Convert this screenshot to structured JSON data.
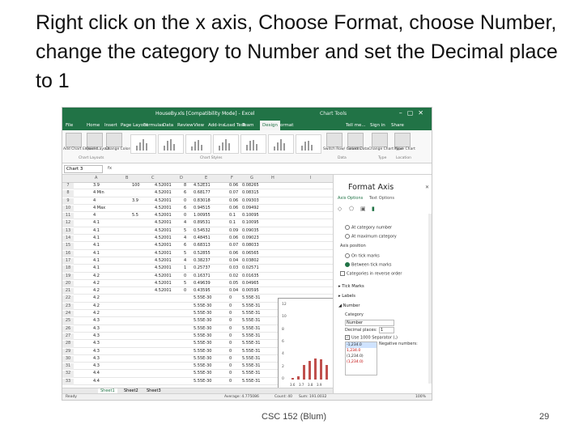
{
  "slide": {
    "title": "Right click on the x axis, Choose Format, choose Number, change the category to Number and set the Decimal place to 1",
    "footer_course": "CSC 152 (Blum)",
    "page_number": "29"
  },
  "excel": {
    "window_title": "HouseBy.xls [Compatibility Mode] - Excel",
    "chart_tools_label": "Chart Tools",
    "menu_tabs": [
      "File",
      "Home",
      "Insert",
      "Page Layout",
      "Formulas",
      "Data",
      "Review",
      "View",
      "Add-ins",
      "Load Test",
      "Team",
      "Design",
      "Format"
    ],
    "menu_right": [
      "Tell me...",
      "Sign in",
      "Share"
    ],
    "active_tab": "Design",
    "ribbon": {
      "add_chart_element": "Add Chart Element",
      "quick_layout": "Quick Layout",
      "change_colors": "Change Colors",
      "switch_row_column": "Switch Row/ Column",
      "select_data": "Select Data",
      "change_chart_type": "Change Chart Type",
      "move_chart": "Move Chart",
      "groups": [
        "Chart Layouts",
        "Chart Styles",
        "Data",
        "Type",
        "Location"
      ]
    },
    "name_box": "Chart 3",
    "fx": "fx",
    "columns": [
      "A",
      "B",
      "C",
      "D",
      "E",
      "F",
      "G",
      "H",
      "I"
    ],
    "rows": [
      {
        "n": "7",
        "cells": [
          "3.9",
          "100",
          "4.52001",
          "8",
          "4.52E31",
          "0.06",
          "0.08265"
        ]
      },
      {
        "n": "8",
        "cells": [
          "4 Min",
          "",
          "4.52001",
          "6",
          "0.68177",
          "0.07",
          "0.08315"
        ]
      },
      {
        "n": "9",
        "cells": [
          "4",
          "3.9",
          "4.52001",
          "0",
          "0.83018",
          "0.06",
          "0.09303"
        ]
      },
      {
        "n": "10",
        "cells": [
          "4 Max",
          "",
          "4.52001",
          "6",
          "0.94515",
          "0.06",
          "0.09492"
        ]
      },
      {
        "n": "11",
        "cells": [
          "4",
          "5.5",
          "4.52001",
          "0",
          "1.00955",
          "0.1",
          "0.10095"
        ]
      },
      {
        "n": "12",
        "cells": [
          "4.1",
          "",
          "4.52001",
          "4",
          "0.89531",
          "0.1",
          "0.10095"
        ]
      },
      {
        "n": "13",
        "cells": [
          "4.1",
          "",
          "4.52001",
          "5",
          "0.54532",
          "0.09",
          "0.09035"
        ]
      },
      {
        "n": "14",
        "cells": [
          "4.1",
          "",
          "4.52001",
          "4",
          "0.48451",
          "0.06",
          "0.09023"
        ]
      },
      {
        "n": "15",
        "cells": [
          "4.1",
          "",
          "4.52001",
          "6",
          "0.68313",
          "0.07",
          "0.08033"
        ]
      },
      {
        "n": "16",
        "cells": [
          "4.1",
          "",
          "4.52001",
          "5",
          "0.52855",
          "0.06",
          "0.06565"
        ]
      },
      {
        "n": "17",
        "cells": [
          "4.1",
          "",
          "4.52001",
          "4",
          "0.38237",
          "0.04",
          "0.03802"
        ]
      },
      {
        "n": "18",
        "cells": [
          "4.1",
          "",
          "4.52001",
          "1",
          "0.25737",
          "0.03",
          "0.02571"
        ]
      },
      {
        "n": "19",
        "cells": [
          "4.2",
          "",
          "4.52001",
          "0",
          "0.16371",
          "0.02",
          "0.01635"
        ]
      },
      {
        "n": "20",
        "cells": [
          "4.2",
          "",
          "4.52001",
          "5",
          "0.49639",
          "0.05",
          "0.04965"
        ]
      },
      {
        "n": "21",
        "cells": [
          "4.2",
          "",
          "4.52001",
          "0",
          "0.43595",
          "0.04",
          "0.00595"
        ]
      },
      {
        "n": "22",
        "cells": [
          "4.2",
          "",
          "",
          "",
          "5.55E-30",
          "0",
          "5.55E-31"
        ]
      },
      {
        "n": "23",
        "cells": [
          "4.2",
          "",
          "",
          "",
          "5.55E-30",
          "0",
          "5.55E-31"
        ]
      },
      {
        "n": "24",
        "cells": [
          "4.2",
          "",
          "",
          "",
          "5.55E-30",
          "0",
          "5.55E-31"
        ]
      },
      {
        "n": "25",
        "cells": [
          "4.3",
          "",
          "",
          "",
          "5.55E-30",
          "0",
          "5.55E-31"
        ]
      },
      {
        "n": "26",
        "cells": [
          "4.3",
          "",
          "",
          "",
          "5.55E-30",
          "0",
          "5.55E-31"
        ]
      },
      {
        "n": "27",
        "cells": [
          "4.3",
          "",
          "",
          "",
          "5.55E-30",
          "0",
          "5.55E-31"
        ]
      },
      {
        "n": "28",
        "cells": [
          "4.3",
          "",
          "",
          "",
          "5.55E-30",
          "0",
          "5.55E-31"
        ]
      },
      {
        "n": "29",
        "cells": [
          "4.3",
          "",
          "",
          "",
          "5.55E-30",
          "0",
          "5.55E-31"
        ]
      },
      {
        "n": "30",
        "cells": [
          "4.3",
          "",
          "",
          "",
          "5.55E-30",
          "0",
          "5.55E-31"
        ]
      },
      {
        "n": "31",
        "cells": [
          "4.3",
          "",
          "",
          "",
          "5.55E-30",
          "0",
          "5.55E-31"
        ]
      },
      {
        "n": "32",
        "cells": [
          "4.4",
          "",
          "",
          "",
          "5.55E-30",
          "0",
          "5.55E-31"
        ]
      },
      {
        "n": "33",
        "cells": [
          "4.4",
          "",
          "",
          "",
          "5.55E-30",
          "0",
          "5.55E-31"
        ]
      }
    ],
    "chart": {
      "y_ticks": [
        "12",
        "10",
        "8",
        "6",
        "4",
        "2",
        "0"
      ],
      "x_labels": [
        "3.6",
        "3.7",
        "3.8",
        "3.9"
      ],
      "bar_values": [
        0.3,
        0.5,
        2.3,
        3.0,
        3.4,
        3.2,
        2.4
      ]
    },
    "sheet_tabs": [
      "Sheet1",
      "Sheet2",
      "Sheet3"
    ],
    "status": {
      "ready": "Ready",
      "average": "Average: 4.775086",
      "count": "Count: 40",
      "sum": "Sum: 191.0032",
      "zoom": "100%"
    },
    "format_pane": {
      "title": "Format Axis",
      "axis_options": "Axis Options",
      "text_options": "Text Options",
      "at_category": "At category number",
      "at_max": "At maximum category",
      "axis_position": "Axis position",
      "on_tick": "On tick marks",
      "between_tick": "Between tick marks",
      "reverse": "Categories in reverse order",
      "tick_marks": "Tick Marks",
      "labels": "Labels",
      "number": "Number",
      "category_label": "Category",
      "category_value": "Number",
      "decimal_label": "Decimal places:",
      "decimal_value": "1",
      "separator": "Use 1000 Separator (,)",
      "negative_label": "Negative numbers:",
      "negatives": [
        "-1,234.0",
        "1,234.0",
        "(1,234.0)",
        "(1,234.0)"
      ],
      "negative_colors": [
        "#222222",
        "#c00000",
        "#222222",
        "#c00000"
      ]
    }
  }
}
